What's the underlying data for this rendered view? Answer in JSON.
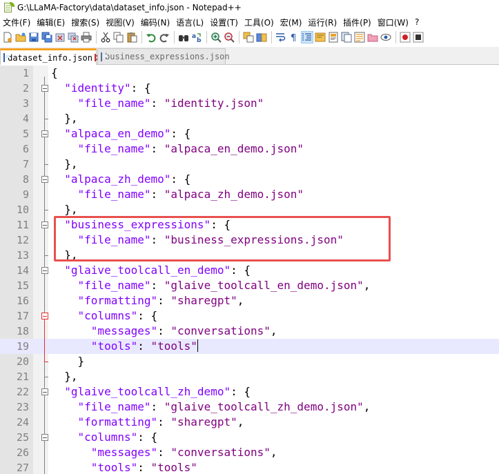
{
  "window": {
    "title": "G:\\LLaMA-Factory\\data\\dataset_info.json - Notepad++"
  },
  "menu": [
    "文件(F)",
    "编辑(E)",
    "搜索(S)",
    "视图(V)",
    "编码(N)",
    "语言(L)",
    "设置(T)",
    "工具(O)",
    "宏(M)",
    "运行(R)",
    "插件(P)",
    "窗口(W)",
    "?"
  ],
  "tabs": [
    {
      "label": "dataset_info.json",
      "active": true
    },
    {
      "label": "business_expressions.json",
      "active": false
    }
  ],
  "colors": {
    "keyword": "#8000ff",
    "string": "#800080",
    "highlight": "#e8504e",
    "current_line": "#e8e8ff",
    "tab_accent": "#f4a020"
  },
  "editor": {
    "current_line": 19,
    "lines": [
      {
        "n": "1",
        "tokens": [
          [
            "p",
            "{"
          ]
        ]
      },
      {
        "n": "2",
        "tokens": [
          [
            "p",
            "  "
          ],
          [
            "k",
            "\"identity\""
          ],
          [
            "p",
            ": {"
          ]
        ]
      },
      {
        "n": "3",
        "tokens": [
          [
            "p",
            "    "
          ],
          [
            "k",
            "\"file_name\""
          ],
          [
            "p",
            ": "
          ],
          [
            "s",
            "\"identity.json\""
          ]
        ]
      },
      {
        "n": "4",
        "tokens": [
          [
            "p",
            "  },"
          ]
        ]
      },
      {
        "n": "5",
        "tokens": [
          [
            "p",
            "  "
          ],
          [
            "k",
            "\"alpaca_en_demo\""
          ],
          [
            "p",
            ": {"
          ]
        ]
      },
      {
        "n": "6",
        "tokens": [
          [
            "p",
            "    "
          ],
          [
            "k",
            "\"file_name\""
          ],
          [
            "p",
            ": "
          ],
          [
            "s",
            "\"alpaca_en_demo.json\""
          ]
        ]
      },
      {
        "n": "7",
        "tokens": [
          [
            "p",
            "  },"
          ]
        ]
      },
      {
        "n": "8",
        "tokens": [
          [
            "p",
            "  "
          ],
          [
            "k",
            "\"alpaca_zh_demo\""
          ],
          [
            "p",
            ": {"
          ]
        ]
      },
      {
        "n": "9",
        "tokens": [
          [
            "p",
            "    "
          ],
          [
            "k",
            "\"file_name\""
          ],
          [
            "p",
            ": "
          ],
          [
            "s",
            "\"alpaca_zh_demo.json\""
          ]
        ]
      },
      {
        "n": "10",
        "tokens": [
          [
            "p",
            "  },"
          ]
        ]
      },
      {
        "n": "11",
        "tokens": [
          [
            "p",
            "  "
          ],
          [
            "k",
            "\"business_expressions\""
          ],
          [
            "p",
            ": {"
          ]
        ]
      },
      {
        "n": "12",
        "tokens": [
          [
            "p",
            "    "
          ],
          [
            "k",
            "\"file_name\""
          ],
          [
            "p",
            ": "
          ],
          [
            "s",
            "\"business_expressions.json\""
          ]
        ]
      },
      {
        "n": "13",
        "tokens": [
          [
            "p",
            "  },"
          ]
        ]
      },
      {
        "n": "14",
        "tokens": [
          [
            "p",
            "  "
          ],
          [
            "k",
            "\"glaive_toolcall_en_demo\""
          ],
          [
            "p",
            ": {"
          ]
        ]
      },
      {
        "n": "15",
        "tokens": [
          [
            "p",
            "    "
          ],
          [
            "k",
            "\"file_name\""
          ],
          [
            "p",
            ": "
          ],
          [
            "s",
            "\"glaive_toolcall_en_demo.json\""
          ],
          [
            "p",
            ","
          ]
        ]
      },
      {
        "n": "16",
        "tokens": [
          [
            "p",
            "    "
          ],
          [
            "k",
            "\"formatting\""
          ],
          [
            "p",
            ": "
          ],
          [
            "s",
            "\"sharegpt\""
          ],
          [
            "p",
            ","
          ]
        ]
      },
      {
        "n": "17",
        "tokens": [
          [
            "p",
            "    "
          ],
          [
            "k",
            "\"columns\""
          ],
          [
            "p",
            ": {"
          ]
        ]
      },
      {
        "n": "18",
        "tokens": [
          [
            "p",
            "      "
          ],
          [
            "k",
            "\"messages\""
          ],
          [
            "p",
            ": "
          ],
          [
            "s",
            "\"conversations\""
          ],
          [
            "p",
            ","
          ]
        ]
      },
      {
        "n": "19",
        "tokens": [
          [
            "p",
            "      "
          ],
          [
            "k",
            "\"tools\""
          ],
          [
            "p",
            ": "
          ],
          [
            "s",
            "\"tools\""
          ]
        ]
      },
      {
        "n": "20",
        "tokens": [
          [
            "p",
            "    }"
          ]
        ]
      },
      {
        "n": "21",
        "tokens": [
          [
            "p",
            "  },"
          ]
        ]
      },
      {
        "n": "22",
        "tokens": [
          [
            "p",
            "  "
          ],
          [
            "k",
            "\"glaive_toolcall_zh_demo\""
          ],
          [
            "p",
            ": {"
          ]
        ]
      },
      {
        "n": "23",
        "tokens": [
          [
            "p",
            "    "
          ],
          [
            "k",
            "\"file_name\""
          ],
          [
            "p",
            ": "
          ],
          [
            "s",
            "\"glaive_toolcall_zh_demo.json\""
          ],
          [
            "p",
            ","
          ]
        ]
      },
      {
        "n": "24",
        "tokens": [
          [
            "p",
            "    "
          ],
          [
            "k",
            "\"formatting\""
          ],
          [
            "p",
            ": "
          ],
          [
            "s",
            "\"sharegpt\""
          ],
          [
            "p",
            ","
          ]
        ]
      },
      {
        "n": "25",
        "tokens": [
          [
            "p",
            "    "
          ],
          [
            "k",
            "\"columns\""
          ],
          [
            "p",
            ": {"
          ]
        ]
      },
      {
        "n": "26",
        "tokens": [
          [
            "p",
            "      "
          ],
          [
            "k",
            "\"messages\""
          ],
          [
            "p",
            ": "
          ],
          [
            "s",
            "\"conversations\""
          ],
          [
            "p",
            ","
          ]
        ]
      },
      {
        "n": "27",
        "tokens": [
          [
            "p",
            "      "
          ],
          [
            "k",
            "\"tools\""
          ],
          [
            "p",
            ": "
          ],
          [
            "s",
            "\"tools\""
          ]
        ]
      }
    ]
  }
}
